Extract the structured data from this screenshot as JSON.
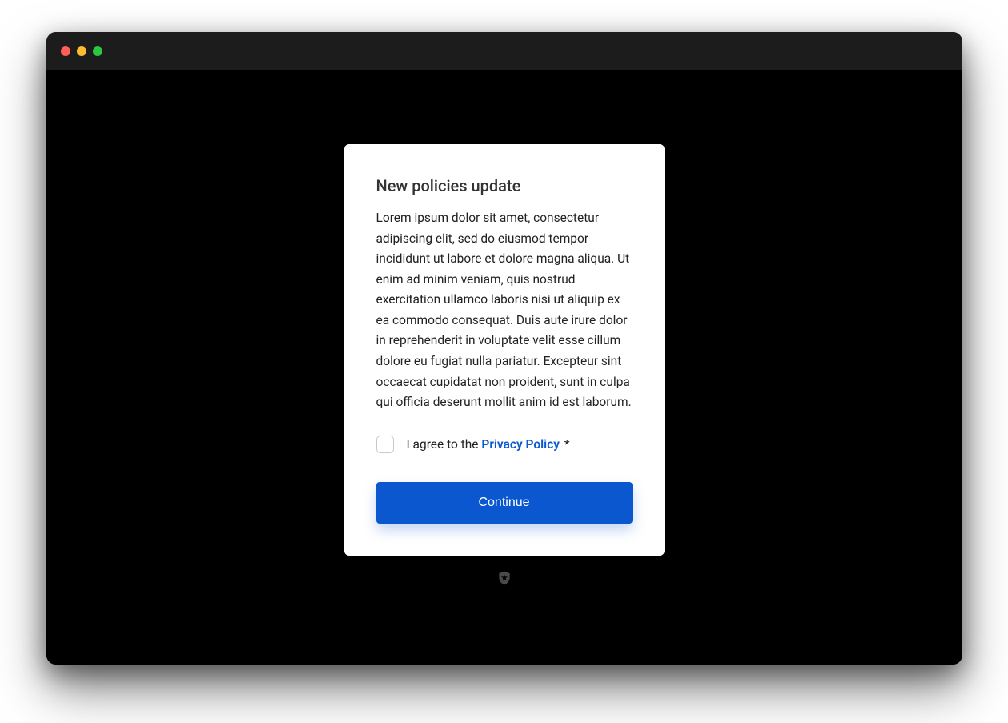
{
  "dialog": {
    "title": "New policies update",
    "body": "Lorem ipsum dolor sit amet, consectetur adipiscing elit, sed do eiusmod tempor incididunt ut labore et dolore magna aliqua. Ut enim ad minim veniam, quis nostrud exercitation ullamco laboris nisi ut aliquip ex ea commodo consequat. Duis aute irure dolor in reprehenderit in voluptate velit esse cillum dolore eu fugiat nulla pariatur. Excepteur sint occaecat cupidatat non proident, sunt in culpa qui officia deserunt mollit anim id est laborum.",
    "agree_prefix": "I agree to the ",
    "policy_link_text": "Privacy Policy",
    "required_mark": " *",
    "checkbox_checked": false,
    "continue_label": "Continue"
  },
  "colors": {
    "primary": "#0a57d0",
    "traffic_red": "#ff5f57",
    "traffic_yellow": "#febc2e",
    "traffic_green": "#28c840"
  }
}
